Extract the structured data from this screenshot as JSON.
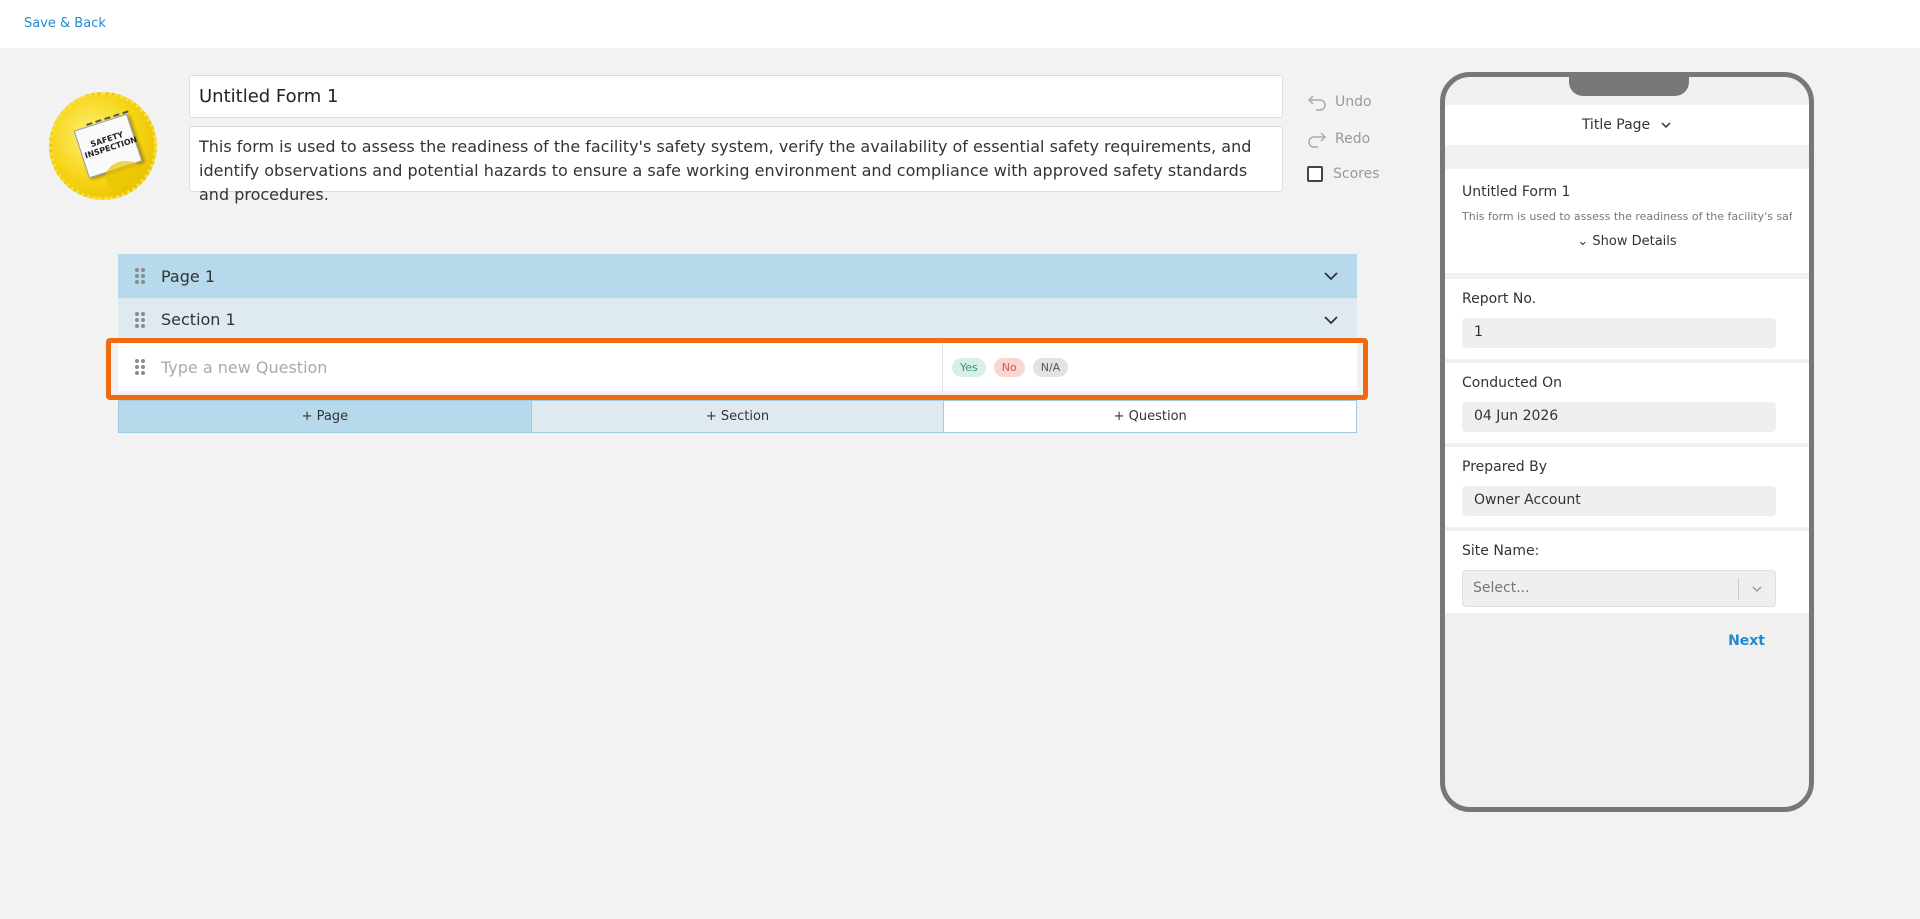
{
  "topbar": {
    "save_back": "Save & Back"
  },
  "logo": {
    "text": "SAFETY INSPECTION"
  },
  "form": {
    "title": "Untitled Form 1",
    "description": "This form is used to assess the readiness of the facility's safety system, verify the availability of essential safety requirements, and identify observations and potential hazards to ensure a safe working environment and compliance with approved safety standards and procedures."
  },
  "actions": {
    "undo": "Undo",
    "redo": "Redo",
    "scores": "Scores"
  },
  "builder": {
    "page_label": "Page 1",
    "section_label": "Section 1",
    "question_placeholder": "Type a new Question",
    "responses": {
      "yes": "Yes",
      "no": "No",
      "na": "N/A"
    },
    "add": {
      "page": "+ Page",
      "section": "+ Section",
      "question": "+ Question"
    }
  },
  "preview": {
    "header": "Title Page",
    "form_title": "Untitled Form 1",
    "form_desc": "This form is used to assess the readiness of the facility's safety system, verify the availability of essential safety requirements, and identify",
    "show_details": "Show Details",
    "fields": {
      "report_no": {
        "label": "Report No.",
        "value": "1"
      },
      "conducted_on": {
        "label": "Conducted On",
        "value": "04 Jun 2026"
      },
      "prepared_by": {
        "label": "Prepared By",
        "value": "Owner Account"
      },
      "site_name": {
        "label": "Site Name:",
        "placeholder": "Select..."
      }
    },
    "next": "Next"
  },
  "colors": {
    "accent": "#1f8ad1",
    "highlight": "#f06a10",
    "page_row": "#b7d9ec",
    "section_row": "#dfe9f0"
  }
}
